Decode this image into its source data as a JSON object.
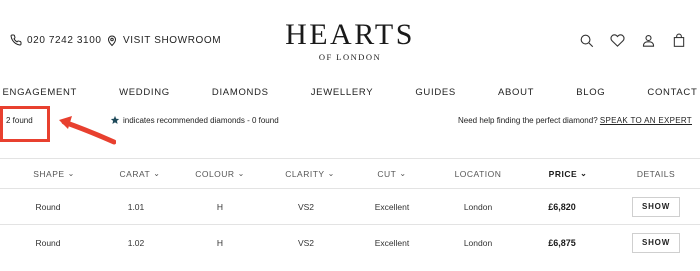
{
  "header": {
    "phone": "020 7242 3100",
    "showroom": "VISIT SHOWROOM",
    "logo_main": "HEARTS",
    "logo_sub": "OF LONDON",
    "icons": [
      "search-icon",
      "heart-icon",
      "account-icon",
      "bag-icon"
    ]
  },
  "nav": {
    "items": [
      "ENGAGEMENT",
      "WEDDING",
      "DIAMONDS",
      "JEWELLERY",
      "GUIDES",
      "ABOUT",
      "BLOG",
      "CONTACT"
    ]
  },
  "results": {
    "found": "2 found",
    "legend_text": "indicates recommended diamonds - 0 found",
    "help_text": "Need help finding the perfect diamond?",
    "help_link": "SPEAK TO AN EXPERT"
  },
  "table": {
    "columns": {
      "shape": "SHAPE",
      "carat": "CARAT",
      "colour": "COLOUR",
      "clarity": "CLARITY",
      "cut": "CUT",
      "location": "LOCATION",
      "price": "PRICE",
      "details": "DETAILS"
    },
    "rows": [
      {
        "shape": "Round",
        "carat": "1.01",
        "colour": "H",
        "clarity": "VS2",
        "cut": "Excellent",
        "location": "London",
        "price": "£6,820",
        "action": "SHOW"
      },
      {
        "shape": "Round",
        "carat": "1.02",
        "colour": "H",
        "clarity": "VS2",
        "cut": "Excellent",
        "location": "London",
        "price": "£6,875",
        "action": "SHOW"
      }
    ]
  },
  "colors": {
    "highlight": "#e8402f",
    "star": "#1f4a5a"
  }
}
